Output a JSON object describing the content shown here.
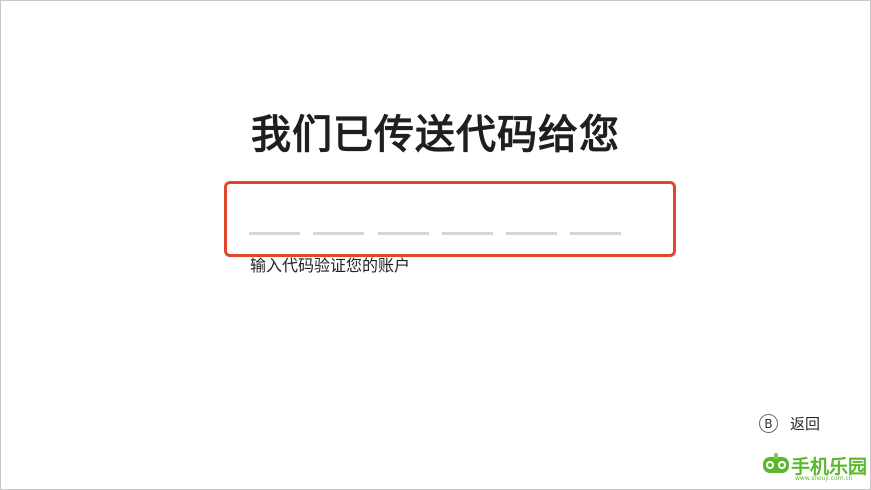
{
  "screen": {
    "title": "我们已传送代码给您",
    "hint": "输入代码验证您的账户"
  },
  "code_input": {
    "slots": [
      "",
      "",
      "",
      "",
      "",
      ""
    ],
    "slot_count": 6,
    "highlight_color": "#e0452f"
  },
  "footer": {
    "back_button_badge": "B",
    "back_label": "返回"
  },
  "watermark": {
    "brand": "手机乐园",
    "url": "www.shouji.com.cn",
    "brand_color": "#5bb82e"
  }
}
